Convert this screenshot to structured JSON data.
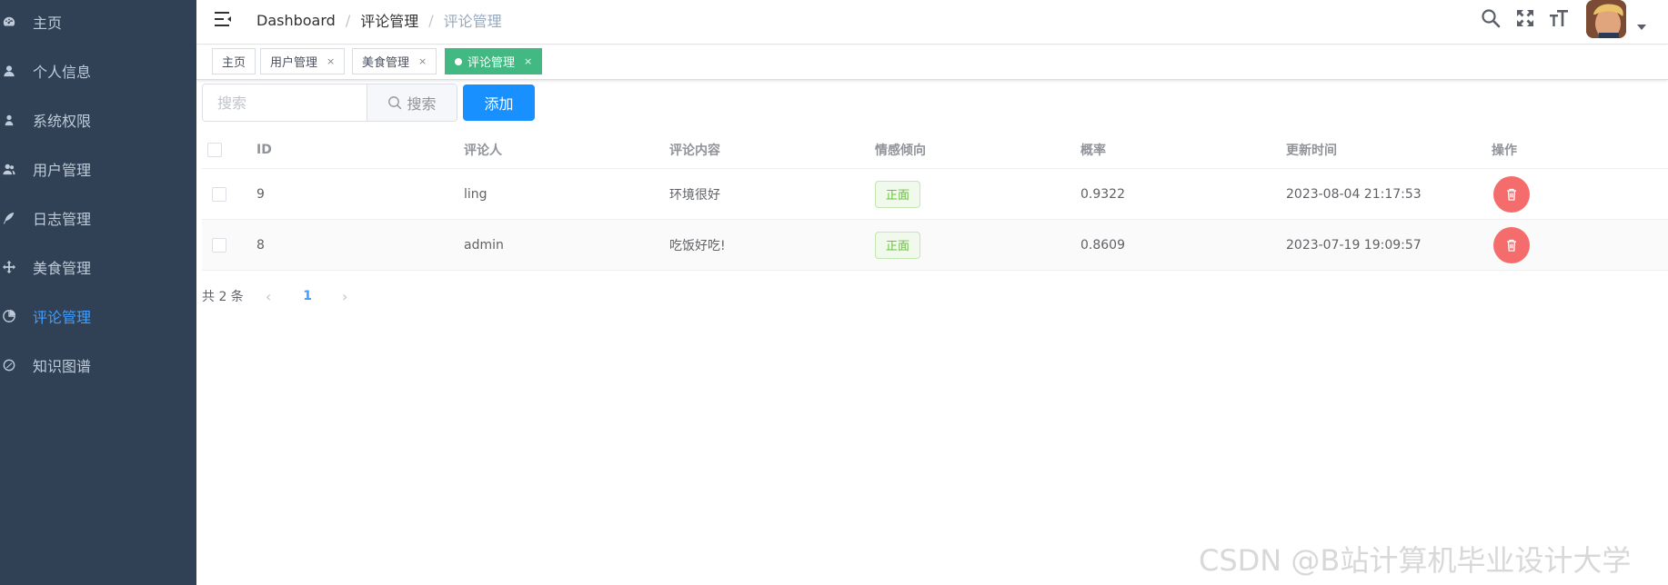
{
  "sidebar": {
    "items": [
      {
        "label": "主页",
        "icon": "dashboard-icon"
      },
      {
        "label": "个人信息",
        "icon": "user-icon"
      },
      {
        "label": "系统权限",
        "icon": "peoples-icon"
      },
      {
        "label": "用户管理",
        "icon": "users-icon"
      },
      {
        "label": "日志管理",
        "icon": "feather-icon"
      },
      {
        "label": "美食管理",
        "icon": "move-icon"
      },
      {
        "label": "评论管理",
        "icon": "chart-icon",
        "active": true
      },
      {
        "label": "知识图谱",
        "icon": "graph-icon"
      }
    ],
    "active_color": "#409eff",
    "bg_color": "#304156"
  },
  "header": {
    "breadcrumb": [
      "Dashboard",
      "评论管理",
      "评论管理"
    ],
    "separator": "/"
  },
  "tags": [
    {
      "label": "主页",
      "closable": false
    },
    {
      "label": "用户管理",
      "closable": true
    },
    {
      "label": "美食管理",
      "closable": true
    },
    {
      "label": "评论管理",
      "closable": true,
      "active": true
    }
  ],
  "toolbar": {
    "search_placeholder": "搜索",
    "search_button": "搜索",
    "add_button": "添加"
  },
  "table": {
    "columns": [
      "ID",
      "评论人",
      "评论内容",
      "情感倾向",
      "概率",
      "更新时间",
      "操作"
    ],
    "rows": [
      {
        "id": "9",
        "user": "ling",
        "content": "环境很好",
        "sentiment": "正面",
        "prob": "0.9322",
        "updated": "2023-08-04 21:17:53"
      },
      {
        "id": "8",
        "user": "admin",
        "content": "吃饭好吃!",
        "sentiment": "正面",
        "prob": "0.8609",
        "updated": "2023-07-19 19:09:57"
      }
    ]
  },
  "pagination": {
    "total_text": "共 2 条",
    "current": "1"
  },
  "watermark": "CSDN @B站计算机毕业设计大学"
}
